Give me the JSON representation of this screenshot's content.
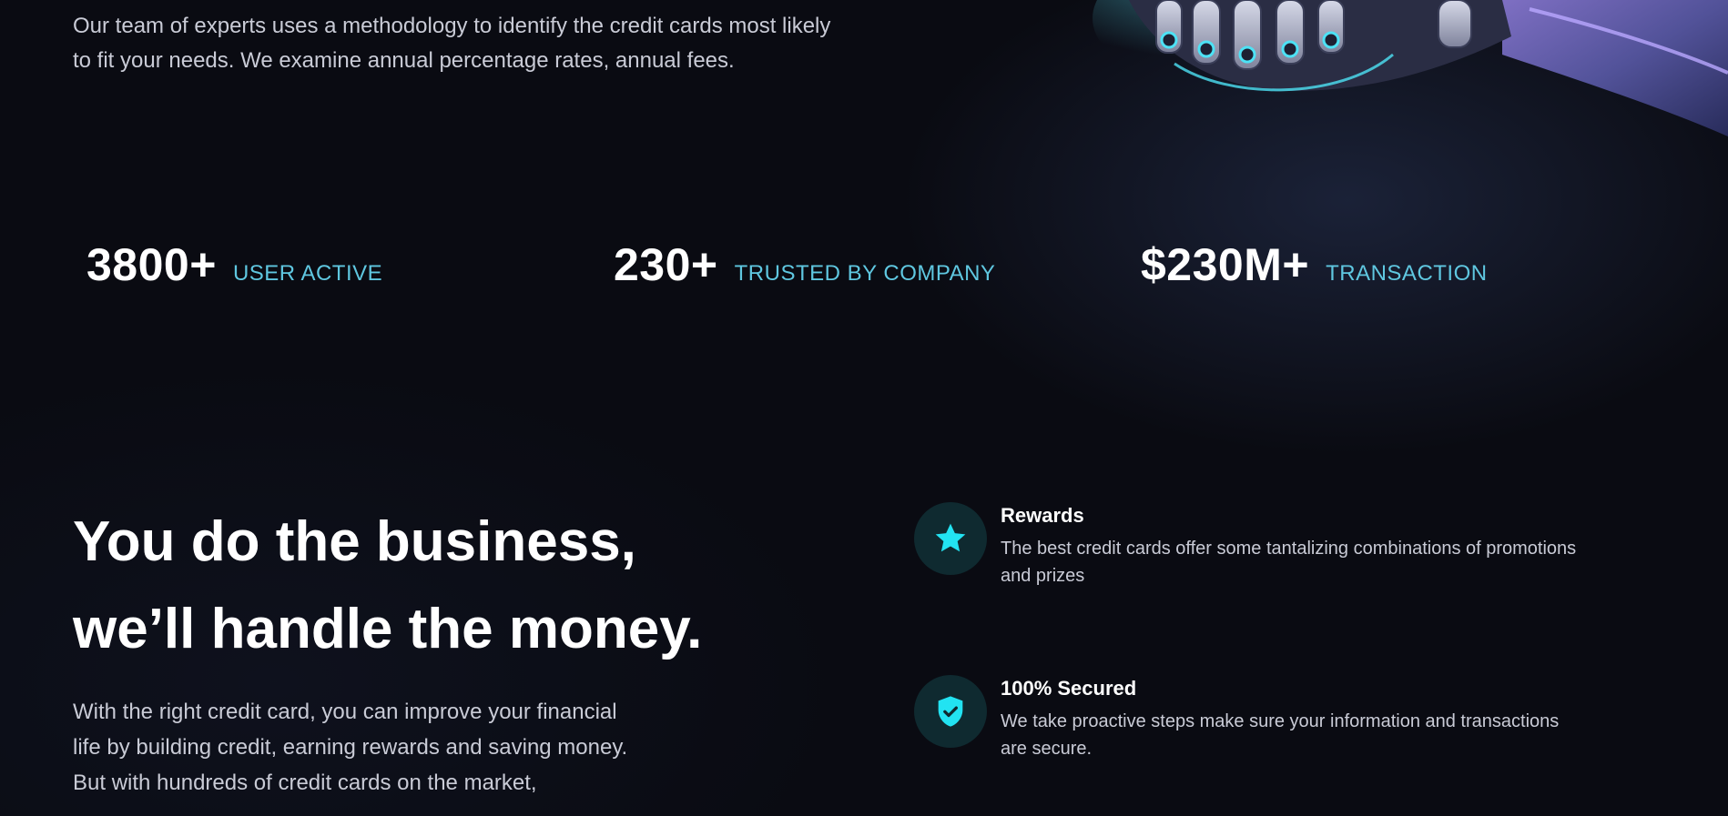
{
  "intro": {
    "text": "Our team of experts uses a methodology to identify the credit cards most likely to fit your needs. We examine annual percentage rates, annual fees."
  },
  "stats": [
    {
      "value": "3800+",
      "label": "USER ACTIVE"
    },
    {
      "value": "230+",
      "label": "TRUSTED BY COMPANY"
    },
    {
      "value": "$230M+",
      "label": "TRANSACTION"
    }
  ],
  "headline": {
    "line1": "You do the business,",
    "line2": "we’ll handle the money."
  },
  "body": {
    "text": "With the right credit card, you can improve your financial life by building credit, earning rewards and saving money. But with hundreds of credit cards on the market,"
  },
  "features": [
    {
      "icon": "star-icon",
      "title": "Rewards",
      "description": "The best credit cards offer some tantalizing combinations of promotions and prizes"
    },
    {
      "icon": "shield-check-icon",
      "title": "100% Secured",
      "description": "We take proactive steps make sure your information and transactions are secure."
    }
  ],
  "colors": {
    "background": "#0a0b12",
    "accent": "#5fc7e0",
    "icon_fill": "#22e3f2",
    "icon_bg": "#0f2a30",
    "muted_text": "#c9cbd6"
  }
}
